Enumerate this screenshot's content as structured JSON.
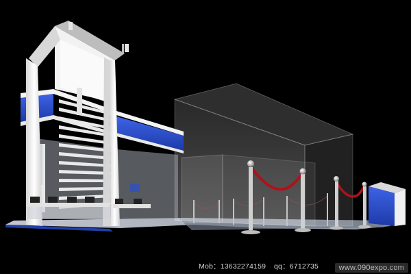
{
  "captions": {
    "mobile": "Mob：13632274159",
    "qq": "qq：6712735",
    "website": "www.090expo.com"
  },
  "colors": {
    "background": "#000000",
    "structure_white": "#eeeeee",
    "banner_blue": "#2a4fd0",
    "glass": "#9aa3ad",
    "rope_red": "#b2101a",
    "post_silver": "#c8c8c8"
  },
  "scene": {
    "subject": "exhibition-booth-render"
  }
}
